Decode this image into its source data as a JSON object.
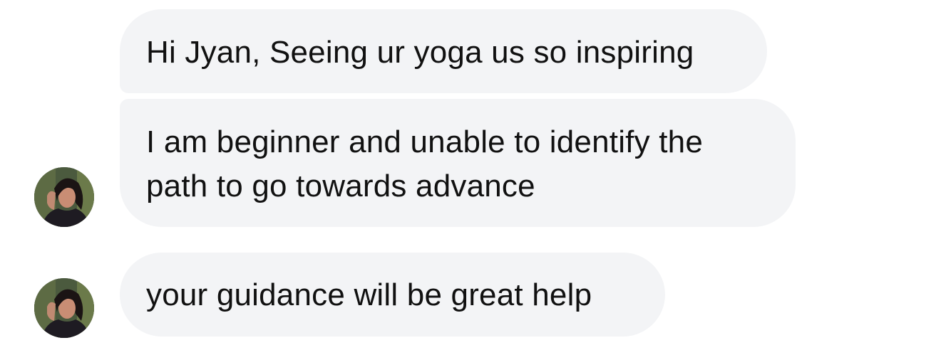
{
  "conversation": {
    "messages": [
      {
        "text": "Hi Jyan, Seeing ur yoga us so inspiring",
        "show_avatar": false
      },
      {
        "text": "I am beginner and unable to identify the\npath to go towards advance",
        "show_avatar": true
      },
      {
        "text": "your guidance will be great help",
        "show_avatar": true
      }
    ],
    "colors": {
      "bubble_bg": "#f3f4f6",
      "text": "#111111",
      "background": "#ffffff"
    },
    "icons": {
      "avatar": "sender-avatar-photo"
    }
  }
}
